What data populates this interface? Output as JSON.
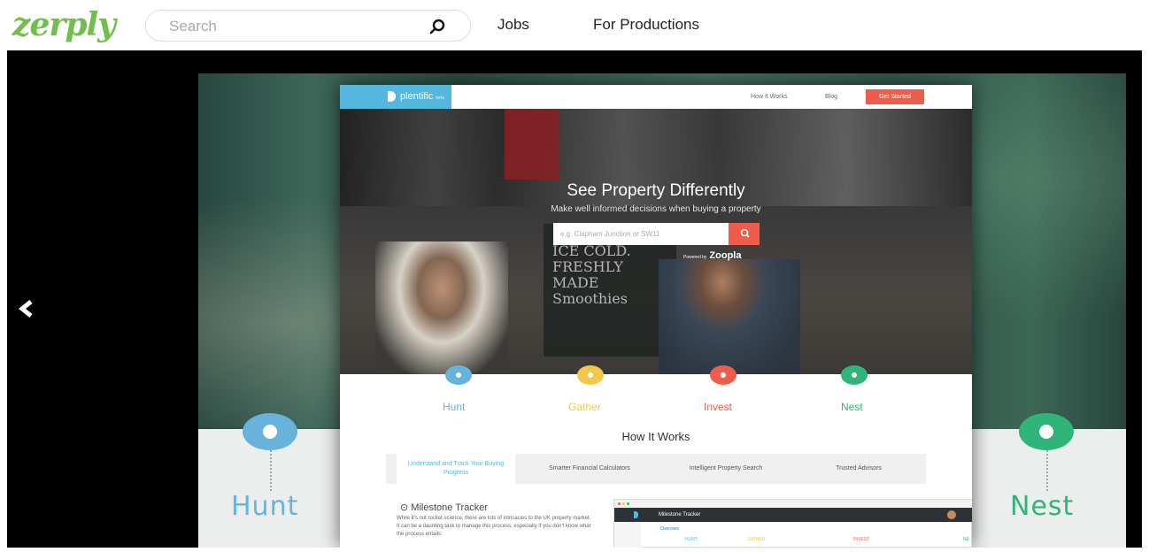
{
  "header": {
    "logo": "zerply",
    "search_placeholder": "Search",
    "nav": [
      "Jobs",
      "For Productions"
    ]
  },
  "viewer": {
    "bg_steps": [
      {
        "label": "Hunt",
        "color": "#67b3dc"
      },
      {
        "label": "Nest",
        "color": "#2fb57a"
      }
    ]
  },
  "site": {
    "brand": "plentific",
    "brand_tag": "beta",
    "nav": [
      "How It Works",
      "Blog"
    ],
    "cta": "Get Started",
    "hero_title": "See Property Differently",
    "hero_subtitle": "Make well informed decisions when buying a property",
    "search_placeholder": "e.g. Clapham Junction or SW11",
    "powered_by": "Powered by",
    "powered_brand": "Zoopla",
    "chalkboard": "ICE COLD.\nFRESHLY\nMADE\nSmoothies",
    "steps": [
      {
        "label": "Hunt",
        "color": "#67b3dc"
      },
      {
        "label": "Gather",
        "color": "#f1c84b"
      },
      {
        "label": "Invest",
        "color": "#ee5c4b"
      },
      {
        "label": "Nest",
        "color": "#2fb57a"
      }
    ],
    "how_title": "How It Works",
    "tabs": [
      "Understand and Track Your Buying Progress",
      "Smarter Financial Calculators",
      "Intelligent Property Search",
      "Trusted Advisors"
    ],
    "milestone_title": "Milestone Tracker",
    "milestone_desc": "While it's not rocket science, there are lots of intricacies to the UK property market. It can be a daunting task to manage this process, especially if you don't know what the process entails.",
    "app": {
      "title": "Milestone Tracker",
      "overview": "Overview",
      "track": [
        "HUNT",
        "GATHER",
        "INVEST",
        "NE"
      ]
    }
  }
}
